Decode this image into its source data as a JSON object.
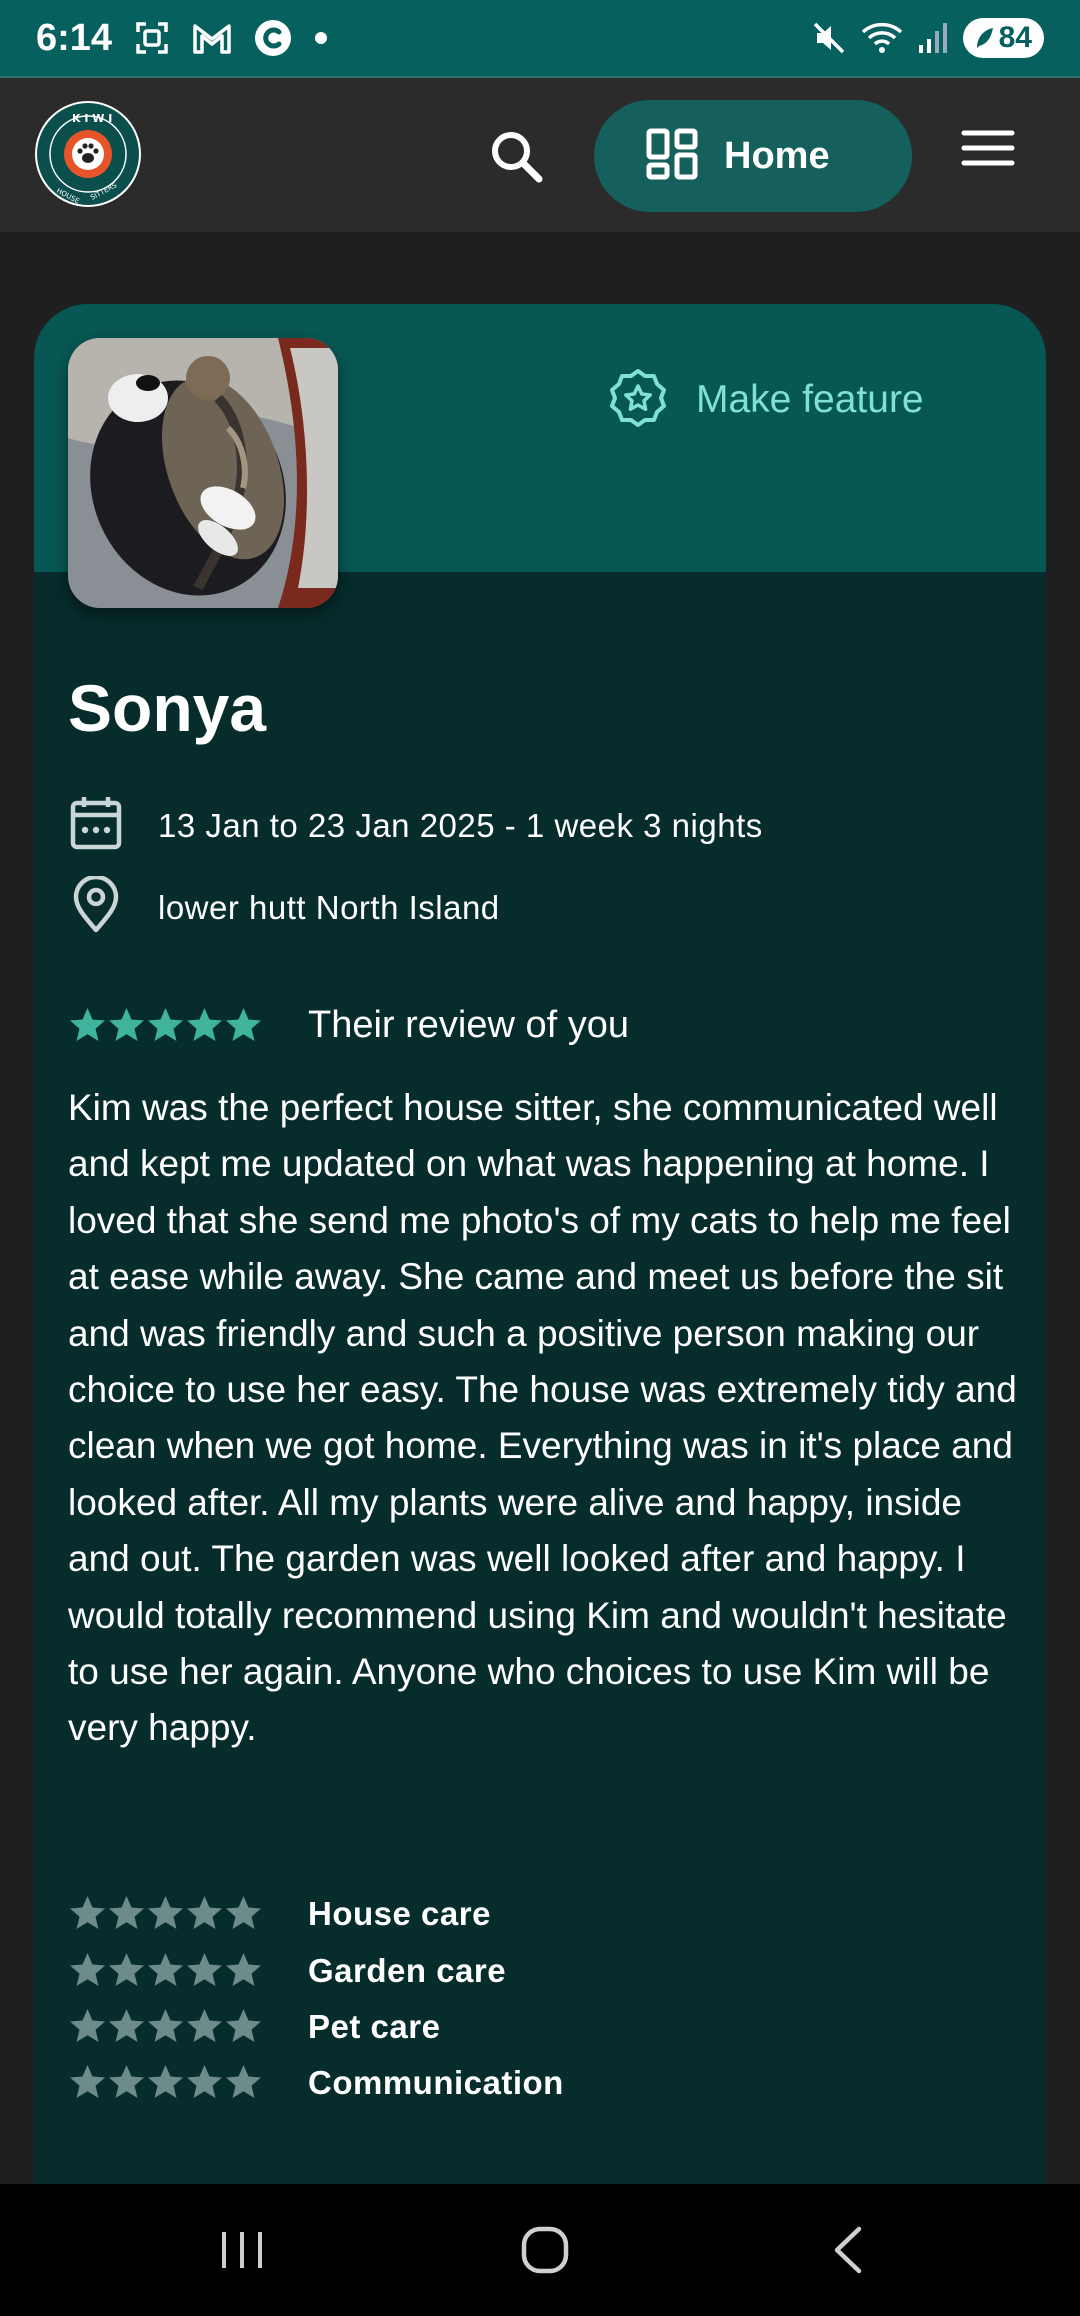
{
  "status_bar": {
    "time": "6:14",
    "battery": "84",
    "icons": [
      "screenshot-icon",
      "gmail-icon",
      "c-app-icon",
      "dot-icon",
      "mute-icon",
      "wifi-icon",
      "signal-icon",
      "battery-icon"
    ]
  },
  "app_bar": {
    "logo_icon": "kiwi-house-sitters-logo",
    "search_icon": "search-icon",
    "home_label": "Home",
    "home_icon": "dashboard-icon",
    "menu_icon": "hamburger-menu-icon"
  },
  "review_card": {
    "feature_label": "Make feature",
    "feature_icon": "star-badge-icon",
    "name": "Sonya",
    "dates": "13 Jan to 23 Jan 2025 - 1 week 3 nights",
    "location": "lower hutt North Island",
    "overall_rating": 5,
    "review_title": "Their review of you",
    "review_text": "Kim was the perfect house sitter, she communicated well and kept me updated on what was happening at home. I loved that she send me photo's of my cats to help me feel at ease while away. She came and meet us before the sit and was friendly and such a positive person making our choice to use her easy. The house was extremely tidy and clean when we got home. Everything was in it's place and looked after. All my plants were alive and happy, inside and out. The garden was well looked after and happy. I would totally recommend using Kim and wouldn't hesitate to use her again. Anyone who choices to use Kim will be very happy.",
    "categories": [
      {
        "label": "House care"
      },
      {
        "label": "Garden care"
      },
      {
        "label": "Pet care"
      },
      {
        "label": "Communication"
      }
    ]
  },
  "colors": {
    "status_bar": "#06605d",
    "card_header": "#075754",
    "card_body": "#062c2b",
    "accent_star": "#3fb39b",
    "muted_star": "#6e8b8b",
    "feature_text": "#7fe0d8"
  }
}
